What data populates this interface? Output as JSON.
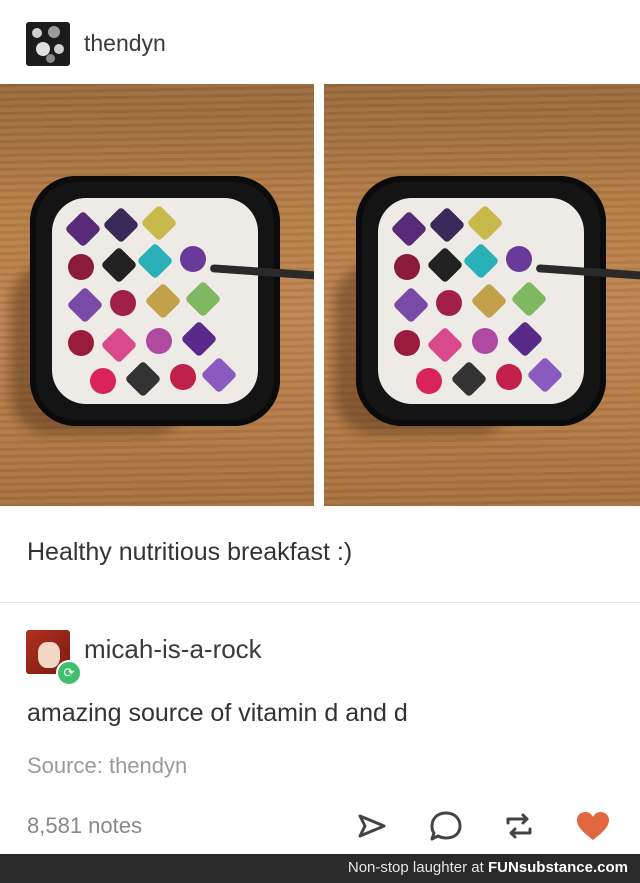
{
  "post": {
    "username": "thendyn",
    "caption": "Healthy nutritious breakfast :)"
  },
  "reblog": {
    "username": "micah-is-a-rock",
    "comment": "amazing source of vitamin d and d"
  },
  "source": {
    "label": "Source:",
    "name": "thendyn"
  },
  "notes": {
    "count_label": "8,581 notes"
  },
  "icons": {
    "share": "share-icon",
    "reply": "reply-icon",
    "reblog": "reblog-icon",
    "like": "heart-icon"
  },
  "colors": {
    "like": "#e2663e",
    "reblog_badge": "#3fbf6f",
    "footer_bg": "#2a2a2a"
  },
  "footer": {
    "text": "Non-stop laughter at",
    "brand": "FUNsubstance.com"
  }
}
